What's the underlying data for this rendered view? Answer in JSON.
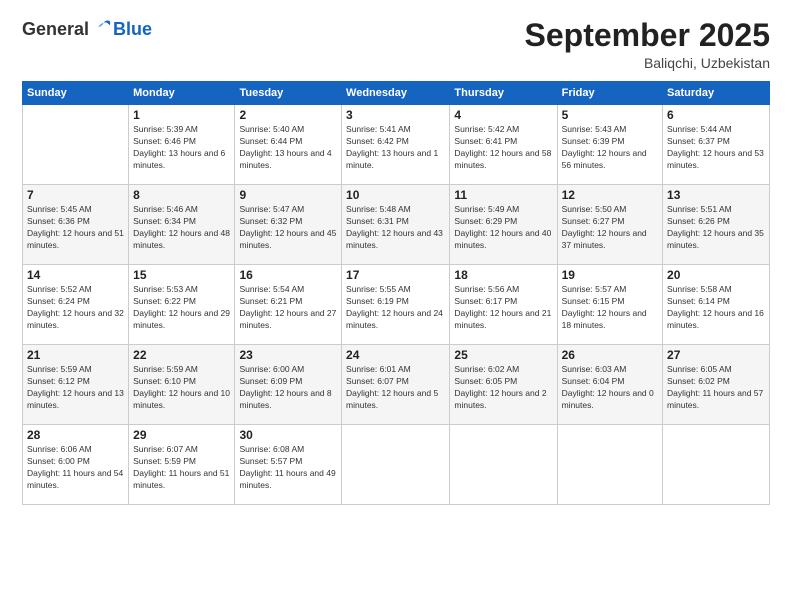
{
  "header": {
    "logo_general": "General",
    "logo_blue": "Blue",
    "month": "September 2025",
    "location": "Baliqchi, Uzbekistan"
  },
  "weekdays": [
    "Sunday",
    "Monday",
    "Tuesday",
    "Wednesday",
    "Thursday",
    "Friday",
    "Saturday"
  ],
  "weeks": [
    [
      {
        "day": "",
        "sunrise": "",
        "sunset": "",
        "daylight": ""
      },
      {
        "day": "1",
        "sunrise": "Sunrise: 5:39 AM",
        "sunset": "Sunset: 6:46 PM",
        "daylight": "Daylight: 13 hours and 6 minutes."
      },
      {
        "day": "2",
        "sunrise": "Sunrise: 5:40 AM",
        "sunset": "Sunset: 6:44 PM",
        "daylight": "Daylight: 13 hours and 4 minutes."
      },
      {
        "day": "3",
        "sunrise": "Sunrise: 5:41 AM",
        "sunset": "Sunset: 6:42 PM",
        "daylight": "Daylight: 13 hours and 1 minute."
      },
      {
        "day": "4",
        "sunrise": "Sunrise: 5:42 AM",
        "sunset": "Sunset: 6:41 PM",
        "daylight": "Daylight: 12 hours and 58 minutes."
      },
      {
        "day": "5",
        "sunrise": "Sunrise: 5:43 AM",
        "sunset": "Sunset: 6:39 PM",
        "daylight": "Daylight: 12 hours and 56 minutes."
      },
      {
        "day": "6",
        "sunrise": "Sunrise: 5:44 AM",
        "sunset": "Sunset: 6:37 PM",
        "daylight": "Daylight: 12 hours and 53 minutes."
      }
    ],
    [
      {
        "day": "7",
        "sunrise": "Sunrise: 5:45 AM",
        "sunset": "Sunset: 6:36 PM",
        "daylight": "Daylight: 12 hours and 51 minutes."
      },
      {
        "day": "8",
        "sunrise": "Sunrise: 5:46 AM",
        "sunset": "Sunset: 6:34 PM",
        "daylight": "Daylight: 12 hours and 48 minutes."
      },
      {
        "day": "9",
        "sunrise": "Sunrise: 5:47 AM",
        "sunset": "Sunset: 6:32 PM",
        "daylight": "Daylight: 12 hours and 45 minutes."
      },
      {
        "day": "10",
        "sunrise": "Sunrise: 5:48 AM",
        "sunset": "Sunset: 6:31 PM",
        "daylight": "Daylight: 12 hours and 43 minutes."
      },
      {
        "day": "11",
        "sunrise": "Sunrise: 5:49 AM",
        "sunset": "Sunset: 6:29 PM",
        "daylight": "Daylight: 12 hours and 40 minutes."
      },
      {
        "day": "12",
        "sunrise": "Sunrise: 5:50 AM",
        "sunset": "Sunset: 6:27 PM",
        "daylight": "Daylight: 12 hours and 37 minutes."
      },
      {
        "day": "13",
        "sunrise": "Sunrise: 5:51 AM",
        "sunset": "Sunset: 6:26 PM",
        "daylight": "Daylight: 12 hours and 35 minutes."
      }
    ],
    [
      {
        "day": "14",
        "sunrise": "Sunrise: 5:52 AM",
        "sunset": "Sunset: 6:24 PM",
        "daylight": "Daylight: 12 hours and 32 minutes."
      },
      {
        "day": "15",
        "sunrise": "Sunrise: 5:53 AM",
        "sunset": "Sunset: 6:22 PM",
        "daylight": "Daylight: 12 hours and 29 minutes."
      },
      {
        "day": "16",
        "sunrise": "Sunrise: 5:54 AM",
        "sunset": "Sunset: 6:21 PM",
        "daylight": "Daylight: 12 hours and 27 minutes."
      },
      {
        "day": "17",
        "sunrise": "Sunrise: 5:55 AM",
        "sunset": "Sunset: 6:19 PM",
        "daylight": "Daylight: 12 hours and 24 minutes."
      },
      {
        "day": "18",
        "sunrise": "Sunrise: 5:56 AM",
        "sunset": "Sunset: 6:17 PM",
        "daylight": "Daylight: 12 hours and 21 minutes."
      },
      {
        "day": "19",
        "sunrise": "Sunrise: 5:57 AM",
        "sunset": "Sunset: 6:15 PM",
        "daylight": "Daylight: 12 hours and 18 minutes."
      },
      {
        "day": "20",
        "sunrise": "Sunrise: 5:58 AM",
        "sunset": "Sunset: 6:14 PM",
        "daylight": "Daylight: 12 hours and 16 minutes."
      }
    ],
    [
      {
        "day": "21",
        "sunrise": "Sunrise: 5:59 AM",
        "sunset": "Sunset: 6:12 PM",
        "daylight": "Daylight: 12 hours and 13 minutes."
      },
      {
        "day": "22",
        "sunrise": "Sunrise: 5:59 AM",
        "sunset": "Sunset: 6:10 PM",
        "daylight": "Daylight: 12 hours and 10 minutes."
      },
      {
        "day": "23",
        "sunrise": "Sunrise: 6:00 AM",
        "sunset": "Sunset: 6:09 PM",
        "daylight": "Daylight: 12 hours and 8 minutes."
      },
      {
        "day": "24",
        "sunrise": "Sunrise: 6:01 AM",
        "sunset": "Sunset: 6:07 PM",
        "daylight": "Daylight: 12 hours and 5 minutes."
      },
      {
        "day": "25",
        "sunrise": "Sunrise: 6:02 AM",
        "sunset": "Sunset: 6:05 PM",
        "daylight": "Daylight: 12 hours and 2 minutes."
      },
      {
        "day": "26",
        "sunrise": "Sunrise: 6:03 AM",
        "sunset": "Sunset: 6:04 PM",
        "daylight": "Daylight: 12 hours and 0 minutes."
      },
      {
        "day": "27",
        "sunrise": "Sunrise: 6:05 AM",
        "sunset": "Sunset: 6:02 PM",
        "daylight": "Daylight: 11 hours and 57 minutes."
      }
    ],
    [
      {
        "day": "28",
        "sunrise": "Sunrise: 6:06 AM",
        "sunset": "Sunset: 6:00 PM",
        "daylight": "Daylight: 11 hours and 54 minutes."
      },
      {
        "day": "29",
        "sunrise": "Sunrise: 6:07 AM",
        "sunset": "Sunset: 5:59 PM",
        "daylight": "Daylight: 11 hours and 51 minutes."
      },
      {
        "day": "30",
        "sunrise": "Sunrise: 6:08 AM",
        "sunset": "Sunset: 5:57 PM",
        "daylight": "Daylight: 11 hours and 49 minutes."
      },
      {
        "day": "",
        "sunrise": "",
        "sunset": "",
        "daylight": ""
      },
      {
        "day": "",
        "sunrise": "",
        "sunset": "",
        "daylight": ""
      },
      {
        "day": "",
        "sunrise": "",
        "sunset": "",
        "daylight": ""
      },
      {
        "day": "",
        "sunrise": "",
        "sunset": "",
        "daylight": ""
      }
    ]
  ]
}
